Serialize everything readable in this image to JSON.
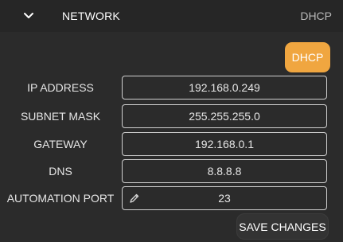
{
  "header": {
    "title": "NETWORK",
    "status": "DHCP",
    "toggle_icon": "chevron-down-icon"
  },
  "dhcp_button": {
    "label": "DHCP",
    "color": "#f0a640"
  },
  "fields": {
    "ip_address": {
      "label": "IP ADDRESS",
      "value": "192.168.0.249"
    },
    "subnet_mask": {
      "label": "SUBNET MASK",
      "value": "255.255.255.0"
    },
    "gateway": {
      "label": "GATEWAY",
      "value": "192.168.0.1"
    },
    "dns": {
      "label": "DNS",
      "value": "8.8.8.8"
    },
    "automation_port": {
      "label": "AUTOMATION PORT",
      "value": "23",
      "icon": "pencil-icon"
    }
  },
  "save_button": {
    "label": "SAVE CHANGES"
  }
}
